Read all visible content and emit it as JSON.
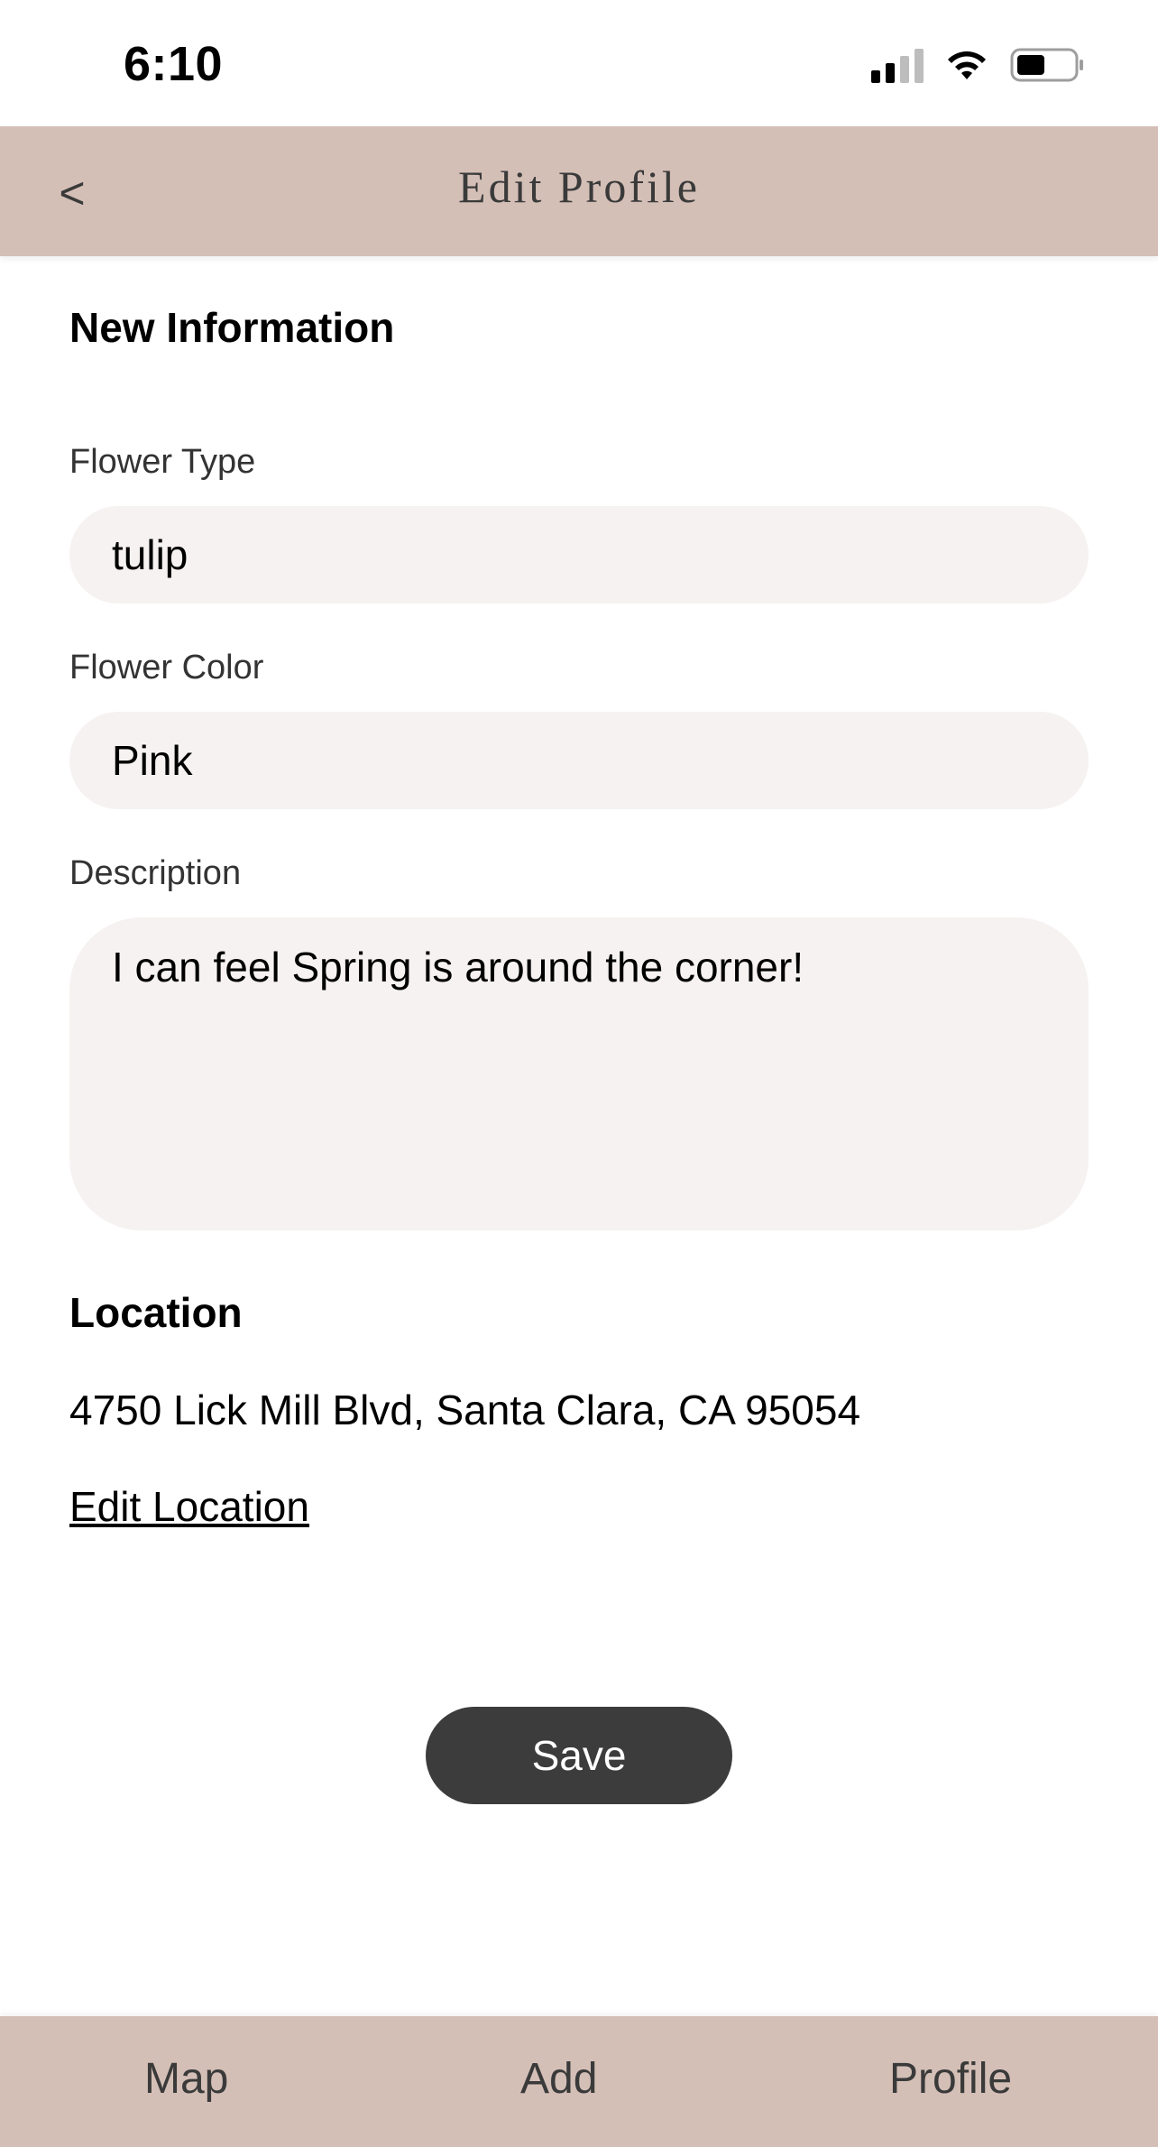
{
  "status_bar": {
    "time": "6:10",
    "icons": [
      "cellular-signal-icon",
      "wifi-icon",
      "battery-icon"
    ]
  },
  "header": {
    "back_label": "<",
    "title": "Edit Profile"
  },
  "form": {
    "section_title": "New Information",
    "flower_type": {
      "label": "Flower Type",
      "value": "tulip"
    },
    "flower_color": {
      "label": "Flower Color",
      "value": "Pink"
    },
    "description": {
      "label": "Description",
      "value": "I can feel Spring is around the corner!"
    }
  },
  "location": {
    "title": "Location",
    "address": "4750 Lick Mill Blvd, Santa Clara, CA 95054",
    "edit_label": "Edit Location"
  },
  "actions": {
    "save_label": "Save"
  },
  "bottom_nav": {
    "items": [
      {
        "label": "Map"
      },
      {
        "label": "Add"
      },
      {
        "label": "Profile"
      }
    ]
  },
  "colors": {
    "header_bg": "#d4bfb7",
    "input_bg": "#f6f2f1",
    "save_button_bg": "#3c3c3c"
  }
}
